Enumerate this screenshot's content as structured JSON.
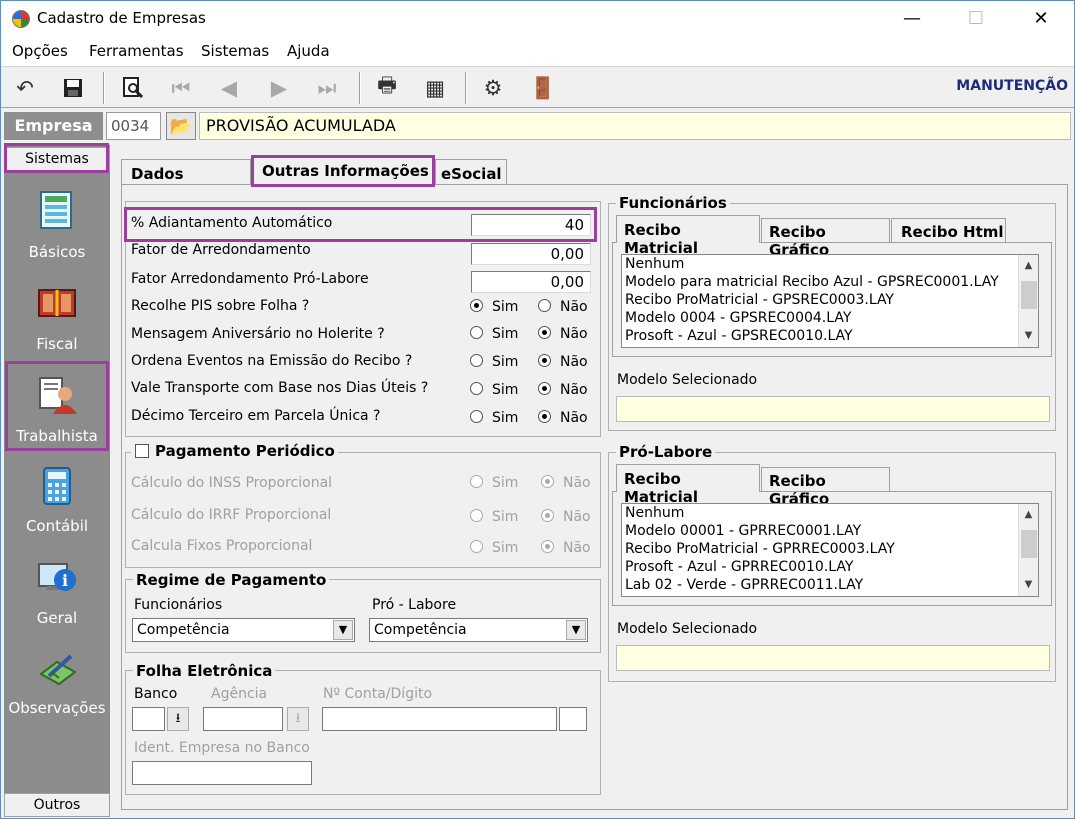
{
  "window": {
    "title": "Cadastro de Empresas",
    "minimize": "—",
    "maximize": "☐",
    "close": "✕"
  },
  "menu": [
    "Opções",
    "Ferramentas",
    "Sistemas",
    "Ajuda"
  ],
  "toolbar": {
    "mode_label": "MANUTENÇÃO"
  },
  "empresa": {
    "label": "Empresa",
    "code": "0034",
    "name": "PROVISÃO ACUMULADA"
  },
  "sidebar": {
    "header": "Sistemas",
    "items": [
      {
        "label": "Básicos",
        "icon": "basicos-icon"
      },
      {
        "label": "Fiscal",
        "icon": "fiscal-icon"
      },
      {
        "label": "Trabalhista",
        "icon": "trabalhista-icon"
      },
      {
        "label": "Contábil",
        "icon": "contabil-icon"
      },
      {
        "label": "Geral",
        "icon": "geral-icon"
      },
      {
        "label": "Observações",
        "icon": "observacoes-icon"
      }
    ],
    "footer": "Outros"
  },
  "tabs": [
    "Dados Básicos",
    "Outras Informações",
    "eSocial"
  ],
  "left": {
    "adiantamento_label": "% Adiantamento Automático",
    "adiantamento_value": "40",
    "fator_label": "Fator de Arredondamento",
    "fator_value": "0,00",
    "fator_pl_label": "Fator Arredondamento Pró-Labore",
    "fator_pl_value": "0,00",
    "radios": [
      {
        "label": "Recolhe PIS sobre Folha ?",
        "sim": "Sim",
        "nao": "Não",
        "selected": "sim"
      },
      {
        "label": "Mensagem Aniversário no Holerite ?",
        "sim": "Sim",
        "nao": "Não",
        "selected": "nao"
      },
      {
        "label": "Ordena Eventos na Emissão do Recibo ?",
        "sim": "Sim",
        "nao": "Não",
        "selected": "nao"
      },
      {
        "label": "Vale Transporte com Base nos Dias Úteis ?",
        "sim": "Sim",
        "nao": "Não",
        "selected": "nao"
      },
      {
        "label": "Décimo Terceiro em Parcela Única ?",
        "sim": "Sim",
        "nao": "Não",
        "selected": "nao"
      }
    ],
    "pagamento_periodico": {
      "label": "Pagamento Periódico",
      "checked": false,
      "rows": [
        {
          "label": "Cálculo do INSS Proporcional",
          "sim": "Sim",
          "nao": "Não"
        },
        {
          "label": "Cálculo do IRRF Proporcional",
          "sim": "Sim",
          "nao": "Não"
        },
        {
          "label": "Calcula Fixos Proporcional",
          "sim": "Sim",
          "nao": "Não"
        }
      ]
    },
    "regime": {
      "label": "Regime de Pagamento",
      "funcionarios_label": "Funcionários",
      "funcionarios_value": "Competência",
      "prolabore_label": "Pró - Labore",
      "prolabore_value": "Competência"
    },
    "folha": {
      "label": "Folha Eletrônica",
      "banco_label": "Banco",
      "agencia_label": "Agência",
      "conta_label": "Nº Conta/Dígito",
      "ident_label": "Ident. Empresa no Banco"
    }
  },
  "right": {
    "funcionarios": {
      "label": "Funcionários",
      "tabs": [
        "Recibo Matricial",
        "Recibo Gráfico",
        "Recibo Html"
      ],
      "list": [
        "Nenhum",
        "Modelo para matricial Recibo Azul - GPSREC0001.LAY",
        "Recibo ProMatricial - GPSREC0003.LAY",
        "Modelo 0004 - GPSREC0004.LAY",
        "Prosoft - Azul - GPSREC0010.LAY"
      ],
      "modelo_label": "Modelo Selecionado"
    },
    "prolabore": {
      "label": "Pró-Labore",
      "tabs": [
        "Recibo Matricial",
        "Recibo Gráfico"
      ],
      "list": [
        "Nenhum",
        "Modelo 00001 - GPRREC0001.LAY",
        "Recibo ProMatricial - GPRREC0003.LAY",
        "Prosoft - Azul - GPRREC0010.LAY",
        "Lab 02 - Verde - GPRREC0011.LAY"
      ],
      "modelo_label": "Modelo Selecionado"
    }
  },
  "colors": {
    "highlight": "#9b3f9e",
    "sidebar": "#8c8c8c",
    "yellow_field": "#ffffe1",
    "manutencao": "#1d2c7a"
  }
}
